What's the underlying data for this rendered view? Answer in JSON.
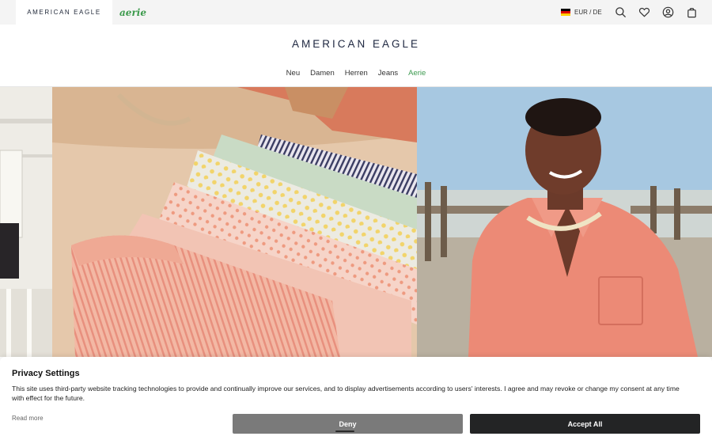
{
  "topbar": {
    "brand_tabs": [
      {
        "label": "AMERICAN EAGLE"
      },
      {
        "label": "aerie"
      }
    ],
    "currency": "EUR / DE",
    "flag_colors": [
      "#000000",
      "#dd0000",
      "#ffce00"
    ],
    "icons": [
      "search-icon",
      "heart-icon",
      "account-icon",
      "bag-icon"
    ]
  },
  "logo": "AMERICAN EAGLE",
  "nav": {
    "items": [
      {
        "label": "Neu"
      },
      {
        "label": "Damen"
      },
      {
        "label": "Herren"
      },
      {
        "label": "Jeans"
      },
      {
        "label": "Aerie",
        "color": "#3d9a50"
      }
    ]
  },
  "hero": {
    "left_image": "folded-striped-and-printed-shorts",
    "right_image": "man-in-coral-shirt-at-beach-pier"
  },
  "privacy": {
    "title": "Privacy Settings",
    "body": "This site uses third-party website tracking technologies to provide and continually improve our services, and to display advertisements according to users' interests. I agree and may revoke or change my consent at any time with effect for the future.",
    "read_more": "Read more",
    "deny_label": "Deny",
    "accept_label": "Accept All"
  },
  "colors": {
    "accent_green": "#3d9a50",
    "deny_button": "#7a7a7a",
    "accept_button": "#232425",
    "logo_navy": "#1e2740"
  }
}
